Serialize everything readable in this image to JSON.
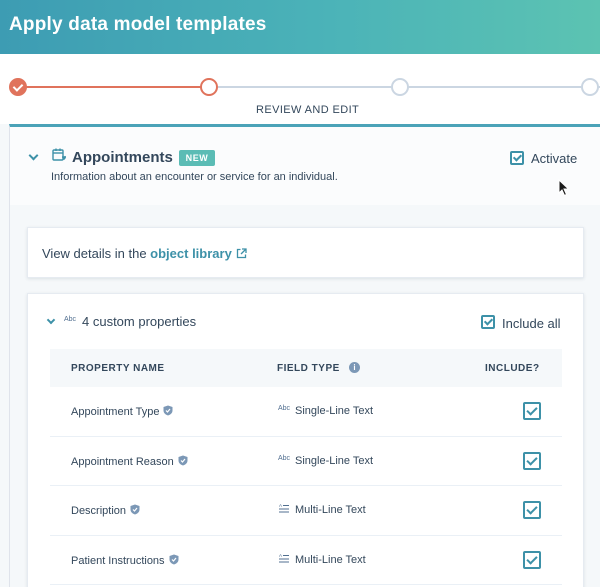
{
  "header": {
    "title": "Apply data model templates"
  },
  "stepper": {
    "current_label": "REVIEW AND EDIT"
  },
  "object": {
    "title": "Appointments",
    "badge": "NEW",
    "description": "Information about an encounter or service for an individual.",
    "activate_label": "Activate",
    "activate_checked": true
  },
  "library": {
    "text": "View details in the ",
    "link": "object library"
  },
  "properties": {
    "abc_icon_text": "Abc",
    "title": "4 custom properties",
    "include_all_label": "Include all",
    "columns": {
      "name": "PROPERTY NAME",
      "type": "FIELD TYPE",
      "include": "INCLUDE?"
    },
    "rows": [
      {
        "name": "Appointment Type",
        "type": "Single-Line Text",
        "type_icon": "Abc",
        "include": true
      },
      {
        "name": "Appointment Reason",
        "type": "Single-Line Text",
        "type_icon": "Abc",
        "include": true
      },
      {
        "name": "Description",
        "type": "Multi-Line Text",
        "type_icon": "multiline-icon",
        "include": true
      },
      {
        "name": "Patient Instructions",
        "type": "Multi-Line Text",
        "type_icon": "multiline-icon",
        "include": true
      }
    ]
  },
  "colors": {
    "accent": "#3d91a8",
    "step_done": "#e0735c",
    "badge": "#5bbcb5"
  }
}
